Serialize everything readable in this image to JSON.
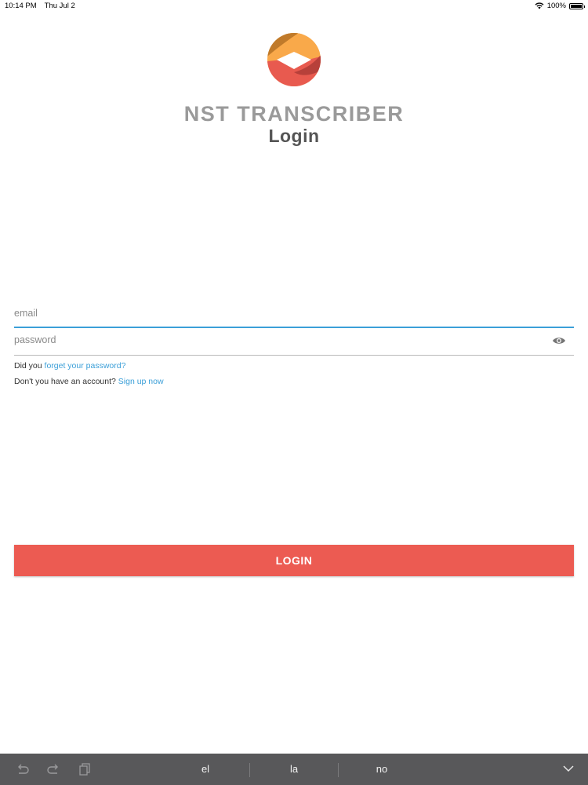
{
  "status_bar": {
    "time": "10:14 PM",
    "date": "Thu Jul 2",
    "battery": "100%",
    "icons": [
      "wifi-icon",
      "battery-icon"
    ]
  },
  "header": {
    "app_name": "NST TRANSCRIBER",
    "page_title": "Login"
  },
  "form": {
    "email_placeholder": "email",
    "email_value": "",
    "password_placeholder": "password",
    "password_value": "",
    "forgot_prefix": "Did you",
    "forgot_link": "forget your password?",
    "signup_prefix": "Don't you have an account?",
    "signup_link": "Sign up now",
    "login_label": "LOGIN"
  },
  "keyboard_bar": {
    "suggestions": [
      "el",
      "la",
      "no"
    ],
    "tools": [
      "undo-icon",
      "redo-icon",
      "paste-icon",
      "dismiss-keyboard-icon"
    ]
  },
  "colors": {
    "accent": "#3b9fd8",
    "button": "#ec5b52",
    "logo_orange": "#f9a94a",
    "logo_brown": "#c07a2a",
    "logo_coral": "#e85a4f",
    "logo_dark_red": "#b7403a",
    "keyboard_bar": "#58585a"
  }
}
